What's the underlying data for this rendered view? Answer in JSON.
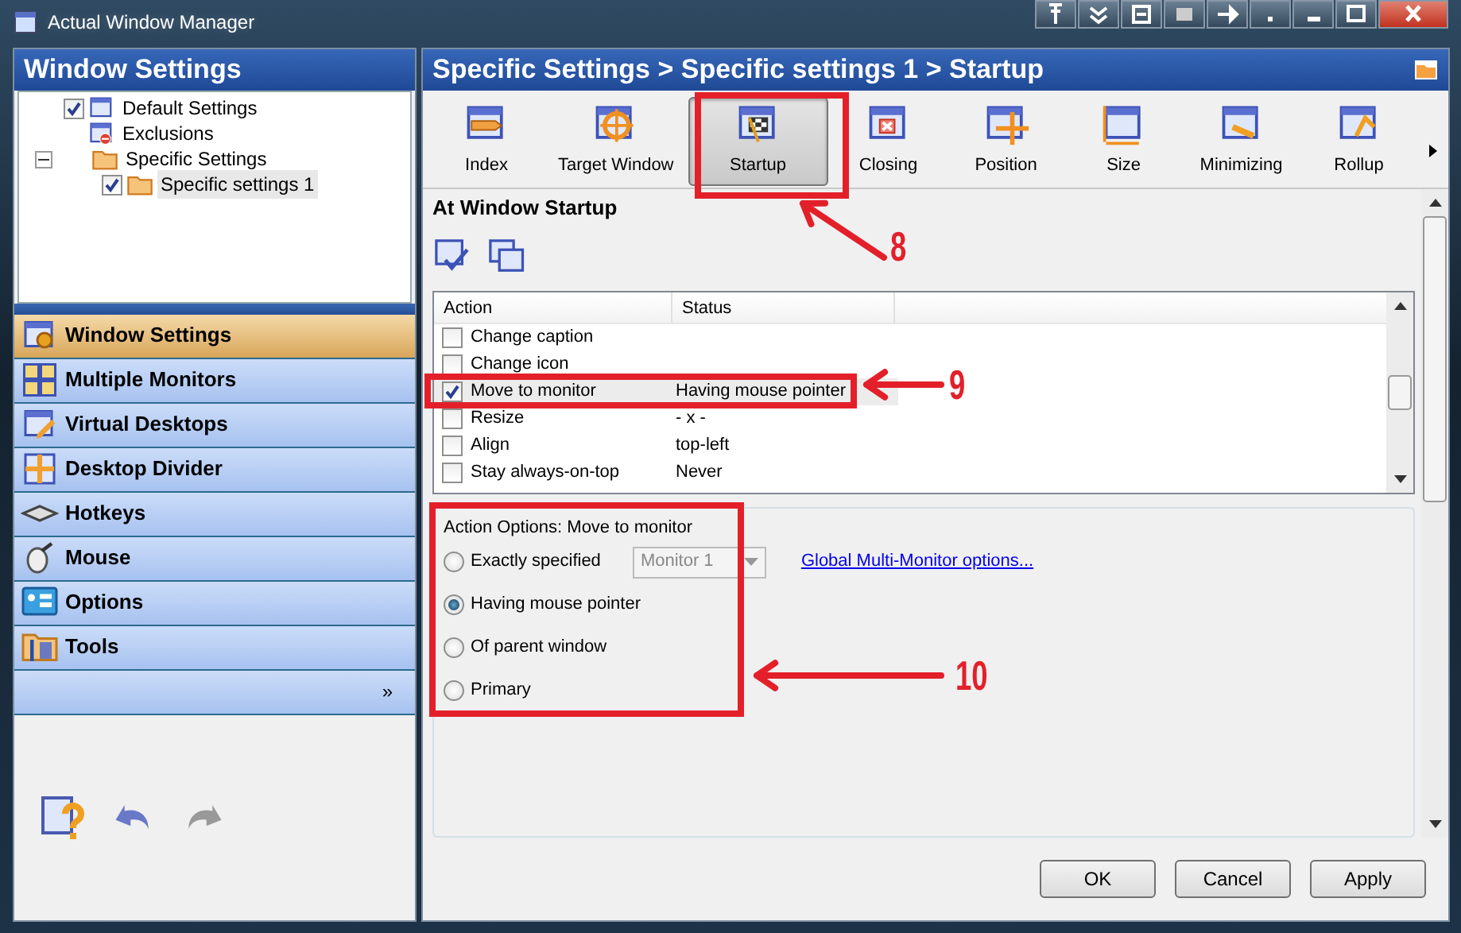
{
  "window": {
    "title": "Actual Window Manager"
  },
  "left_panel": {
    "title": "Window Settings",
    "tree": [
      {
        "label": "Default Settings",
        "kind": "settings",
        "checked": true,
        "selected": false
      },
      {
        "label": "Exclusions",
        "kind": "exclusions",
        "selected": false
      },
      {
        "label": "Specific Settings",
        "kind": "group",
        "expanded": true,
        "selected": false,
        "children": [
          {
            "label": "Specific settings 1",
            "kind": "specific",
            "checked": true,
            "selected": true
          }
        ]
      }
    ],
    "nav": [
      {
        "label": "Window Settings",
        "kind": "window-settings",
        "selected": true
      },
      {
        "label": "Multiple Monitors",
        "kind": "monitors",
        "selected": false
      },
      {
        "label": "Virtual Desktops",
        "kind": "desktops",
        "selected": false
      },
      {
        "label": "Desktop Divider",
        "kind": "divider",
        "selected": false
      },
      {
        "label": "Hotkeys",
        "kind": "keyboard",
        "selected": false
      },
      {
        "label": "Mouse",
        "kind": "mouse",
        "selected": false
      },
      {
        "label": "Options",
        "kind": "options",
        "selected": false
      },
      {
        "label": "Tools",
        "kind": "tools",
        "selected": false
      }
    ],
    "more": "»"
  },
  "right_panel": {
    "breadcrumb": "Specific Settings > Specific settings 1 > Startup",
    "toolbar": [
      {
        "label": "Index",
        "kind": "index",
        "selected": false
      },
      {
        "label": "Target Window",
        "kind": "target",
        "selected": false
      },
      {
        "label": "Startup",
        "kind": "startup",
        "selected": true
      },
      {
        "label": "Closing",
        "kind": "closing",
        "selected": false
      },
      {
        "label": "Position",
        "kind": "position",
        "selected": false
      },
      {
        "label": "Size",
        "kind": "size",
        "selected": false
      },
      {
        "label": "Minimizing",
        "kind": "minimizing",
        "selected": false
      },
      {
        "label": "Rollup",
        "kind": "rollup",
        "selected": false
      }
    ],
    "section_title": "At Window Startup",
    "table": {
      "columns": [
        "Action",
        "Status"
      ],
      "rows": [
        {
          "action": "Change caption",
          "status": "",
          "checked": false,
          "selected": false
        },
        {
          "action": "Change icon",
          "status": "",
          "checked": false,
          "selected": false
        },
        {
          "action": "Move to monitor",
          "status": "Having mouse pointer",
          "checked": true,
          "selected": true
        },
        {
          "action": "Resize",
          "status": "- x -",
          "checked": false,
          "selected": false
        },
        {
          "action": "Align",
          "status": "top-left",
          "checked": false,
          "selected": false
        },
        {
          "action": "Stay always-on-top",
          "status": "Never",
          "checked": false,
          "selected": false
        }
      ]
    },
    "options": {
      "title": "Action Options: Move to monitor",
      "radios": [
        {
          "label": "Exactly specified",
          "selected": false
        },
        {
          "label": "Having mouse pointer",
          "selected": true
        },
        {
          "label": "Of parent window",
          "selected": false
        },
        {
          "label": "Primary",
          "selected": false
        }
      ],
      "monitor_select": {
        "value": "Monitor 1",
        "disabled": true
      },
      "link": "Global Multi-Monitor options..."
    },
    "buttons": [
      "OK",
      "Cancel",
      "Apply"
    ]
  },
  "annotations": [
    {
      "label": "8"
    },
    {
      "label": "9"
    },
    {
      "label": "10"
    }
  ]
}
